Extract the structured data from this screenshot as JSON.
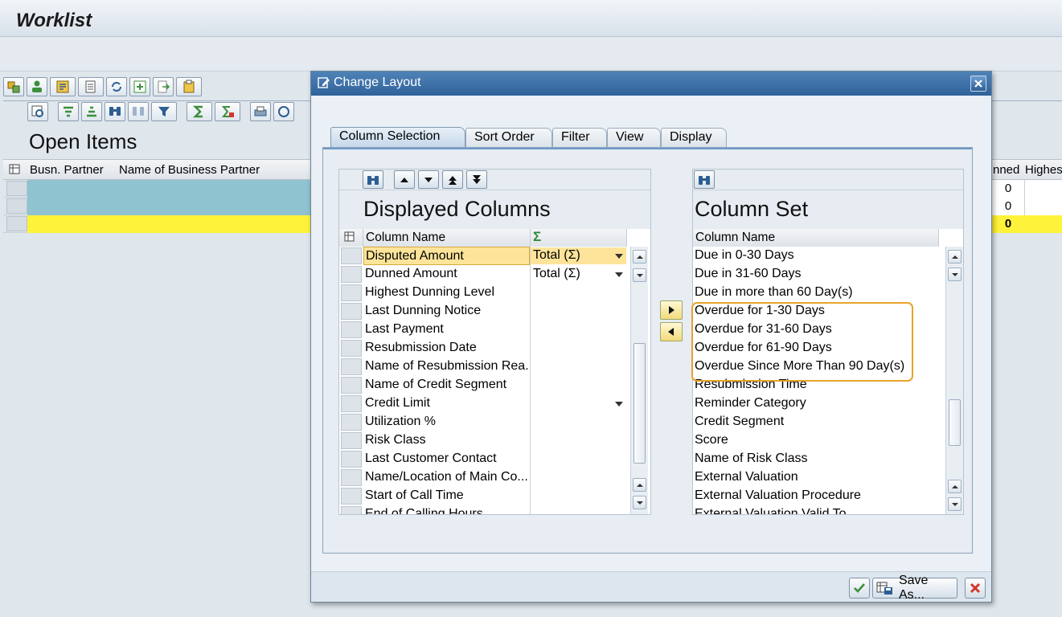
{
  "app": {
    "title": "Worklist",
    "section_title": "Open Items",
    "grid_headers": {
      "busn_partner": "Busn. Partner",
      "name_of_business_partner": "Name of Business Partner",
      "dunned": "nned",
      "highest": "Highes"
    },
    "grid_rows": [
      {
        "dunned_value": "0"
      },
      {
        "dunned_value": "0"
      },
      {
        "dunned_value": "0"
      }
    ],
    "colors": {
      "teal_row": "#8fc3cf",
      "yellow_row": "#fff23a"
    }
  },
  "dialog": {
    "title": "Change Layout",
    "tabs": [
      "Column Selection",
      "Sort Order",
      "Filter",
      "View",
      "Display"
    ],
    "active_tab": "Column Selection",
    "displayed": {
      "title": "Displayed Columns",
      "column_header": "Column Name",
      "sum_header": "Σ",
      "rows": [
        {
          "name": "Disputed Amount",
          "agg": "Total (Σ)"
        },
        {
          "name": "Dunned Amount",
          "agg": "Total (Σ)"
        },
        {
          "name": "Highest Dunning Level",
          "agg": ""
        },
        {
          "name": "Last Dunning Notice",
          "agg": ""
        },
        {
          "name": "Last Payment",
          "agg": ""
        },
        {
          "name": "Resubmission Date",
          "agg": ""
        },
        {
          "name": "Name of Resubmission Rea...",
          "agg": ""
        },
        {
          "name": "Name of Credit Segment",
          "agg": ""
        },
        {
          "name": "Credit Limit",
          "agg": ""
        },
        {
          "name": "Utilization %",
          "agg": ""
        },
        {
          "name": "Risk Class",
          "agg": ""
        },
        {
          "name": "Last Customer Contact",
          "agg": ""
        },
        {
          "name": "Name/Location of Main Co...",
          "agg": ""
        },
        {
          "name": "Start of Call Time",
          "agg": ""
        },
        {
          "name": "End of Calling Hours",
          "agg": ""
        }
      ]
    },
    "column_set": {
      "title": "Column Set",
      "column_header": "Column Name",
      "rows": [
        "Due in 0-30 Days",
        "Due in 31-60 Days",
        "Due in more than 60 Day(s)",
        "Overdue for 1-30 Days",
        "Overdue for 31-60 Days",
        "Overdue for 61-90 Days",
        "Overdue Since More Than 90 Day(s)",
        "Resubmission Time",
        "Reminder Category",
        "Credit Segment",
        "Score",
        "Name of Risk Class",
        "External Valuation",
        "External Valuation Procedure",
        "External Valuation Valid To"
      ]
    },
    "footer": {
      "save_as": "Save As..."
    },
    "colors": {
      "highlight_border": "#e8a32b",
      "selected_row": "#fde49a",
      "title_bar": "#3a6ea5"
    }
  }
}
